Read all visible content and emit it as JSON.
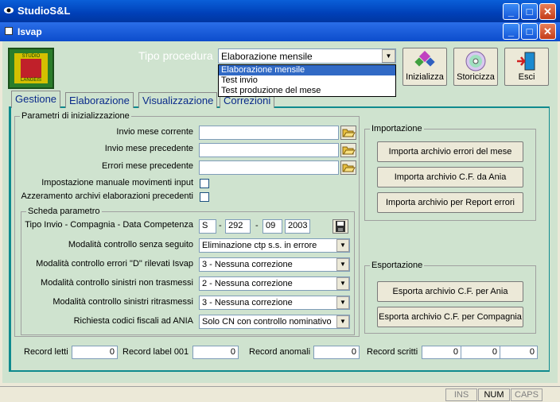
{
  "app_title": "StudioS&L",
  "child_title": "Isvap",
  "logo": {
    "top_text": "STUDIO",
    "bottom_text": "LANGEIS"
  },
  "tipo_procedura": {
    "label": "Tipo procedura",
    "value": "Elaborazione mensile",
    "options": [
      "Elaborazione mensile",
      "Test invio",
      "Test produzione del mese"
    ]
  },
  "toolbar": {
    "inizializza": "Inizializza",
    "storicizza": "Storicizza",
    "esci": "Esci"
  },
  "tabs": [
    "Gestione",
    "Elaborazione",
    "Visualizzazione",
    "Correzioni"
  ],
  "params": {
    "title": "Parametri di inizializzazione",
    "invio_corrente": "Invio mese corrente",
    "invio_precedente": "Invio mese precedente",
    "errori_precedente": "Errori mese precedente",
    "impostazione_manuale": "Impostazione manuale movimenti input",
    "azzeramento": "Azzeramento archivi elaborazioni precedenti"
  },
  "scheda": {
    "title": "Scheda parametro",
    "tipo_invio_label": "Tipo Invio - Compagnia - Data Competenza",
    "tipo": "S",
    "compagnia": "292",
    "mese": "09",
    "anno": "2003",
    "sep": "-",
    "rows": [
      {
        "label": "Modalità controllo senza seguito",
        "value": "Eliminazione ctp s.s. in errore"
      },
      {
        "label": "Modalità controllo errori \"D\" rilevati Isvap",
        "value": "3 - Nessuna correzione"
      },
      {
        "label": "Modalità controllo sinistri non trasmessi",
        "value": "2 - Nessuna correzione"
      },
      {
        "label": "Modalità controllo sinistri ritrasmessi",
        "value": "3 - Nessuna correzione"
      },
      {
        "label": "Richiesta codici fiscali ad ANIA",
        "value": "Solo CN con controllo nominativo"
      }
    ]
  },
  "importazione": {
    "title": "Importazione",
    "buttons": [
      "Importa archivio errori del mese",
      "Importa archivio C.F. da Ania",
      "Importa archivio per Report errori"
    ]
  },
  "esportazione": {
    "title": "Esportazione",
    "buttons": [
      "Esporta archivio C.F. per Ania",
      "Esporta archivio C.F. per Compagnia"
    ]
  },
  "records": {
    "letti_label": "Record letti",
    "letti": "0",
    "label001_label": "Record label 001",
    "label001": "0",
    "anomali_label": "Record anomali",
    "anomali": "0",
    "scritti_label": "Record scritti",
    "scritti": [
      "0",
      "0",
      "0"
    ]
  },
  "status": {
    "ins": "INS",
    "num": "NUM",
    "caps": "CAPS"
  }
}
